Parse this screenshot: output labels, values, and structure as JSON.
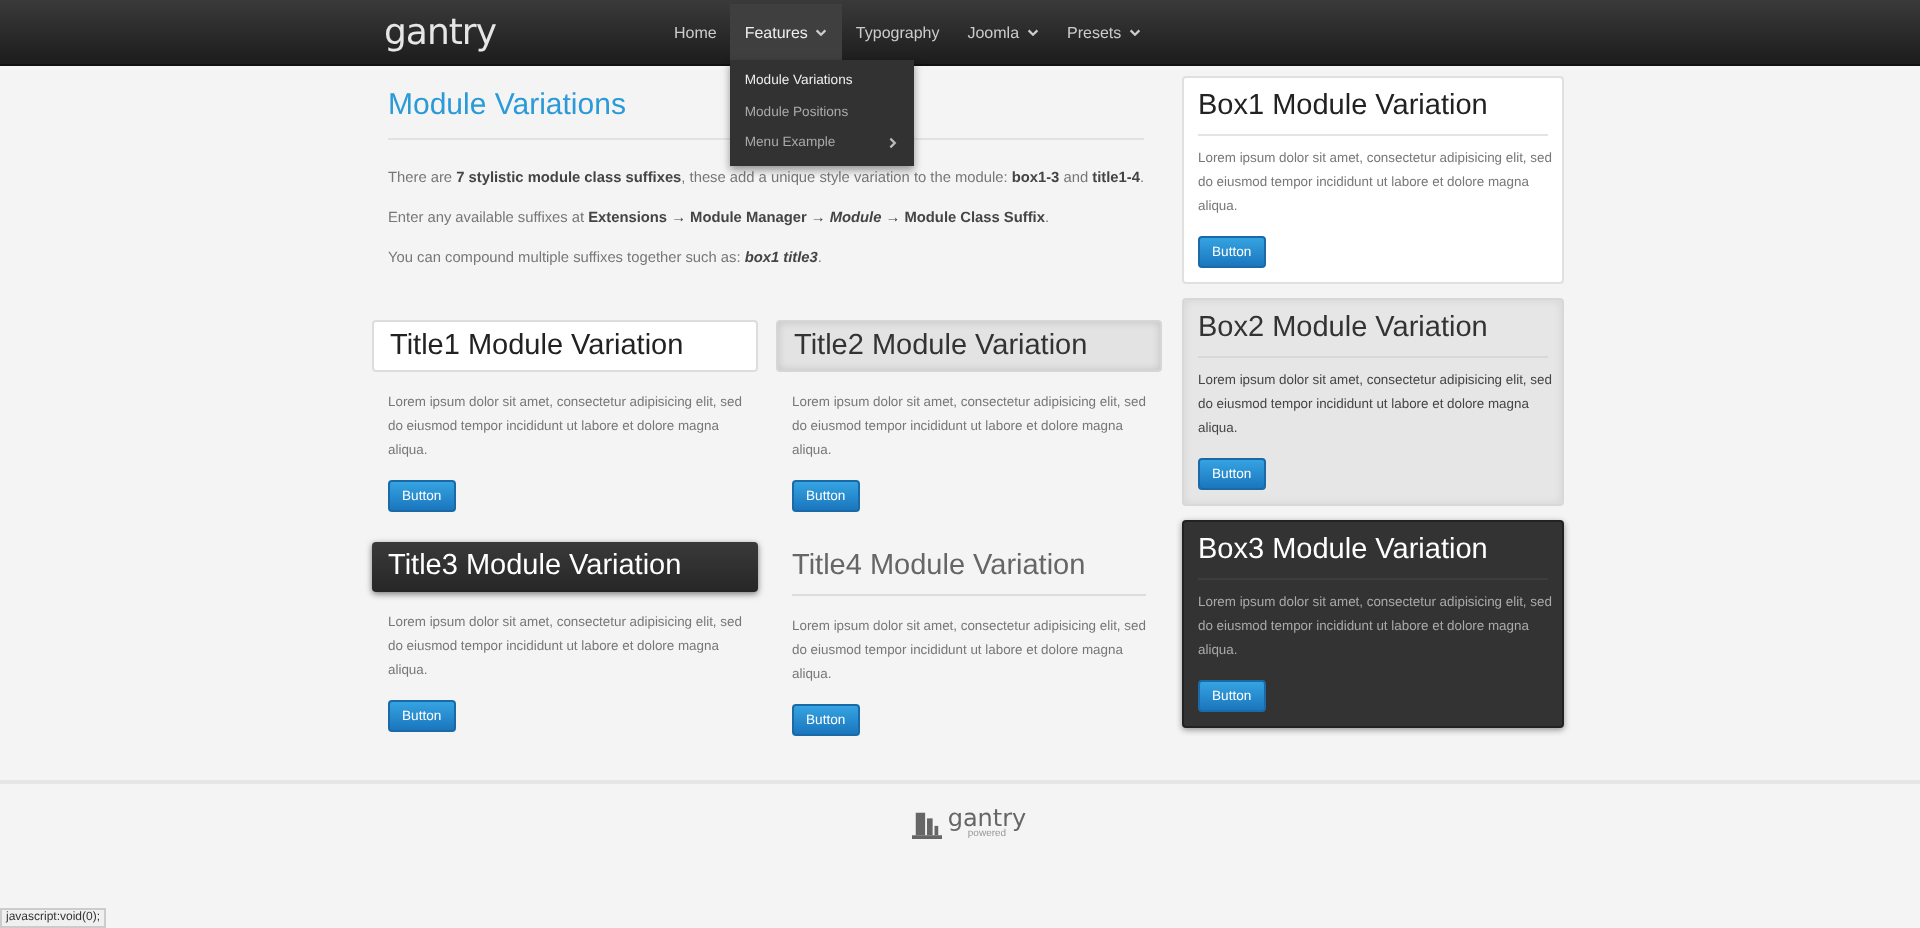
{
  "nav": {
    "logo": "gantry",
    "items": [
      {
        "label": "Home",
        "selected": false,
        "has_menu": false
      },
      {
        "label": "Features",
        "selected": true,
        "has_menu": true
      },
      {
        "label": "Typography",
        "selected": false,
        "has_menu": false
      },
      {
        "label": "Joomla",
        "selected": false,
        "has_menu": true
      },
      {
        "label": "Presets",
        "selected": false,
        "has_menu": true
      }
    ]
  },
  "dropdown": {
    "items": [
      {
        "label": "Module Variations",
        "selected": true,
        "has_submenu": false
      },
      {
        "label": "Module Positions",
        "selected": false,
        "has_submenu": false
      },
      {
        "label": "Menu Example",
        "selected": false,
        "has_submenu": true
      }
    ]
  },
  "intro": {
    "title": "Module Variations",
    "paragraphs": [
      "There are **7 stylistic module class suffixes**, these add a unique style variation to the module: **box1-3** and **title1-4**.",
      "Enter any available suffixes at **Extensions → Module Manager →** *Module* **→ Module Class Suffix**.",
      "You can compound multiple suffixes together such as: *box1 title3*."
    ]
  },
  "modules": [
    {
      "kind": "title1",
      "title": "Title1 Module Variation",
      "text": "Lorem ipsum dolor sit amet, consectetur adipisicing elit, sed do eiusmod tempor incididunt ut labore et dolore magna aliqua.",
      "button": "Button"
    },
    {
      "kind": "title2",
      "title": "Title2 Module Variation",
      "text": "Lorem ipsum dolor sit amet, consectetur adipisicing elit, sed do eiusmod tempor incididunt ut labore et dolore magna aliqua.",
      "button": "Button"
    },
    {
      "kind": "title3",
      "title": "Title3 Module Variation",
      "text": "Lorem ipsum dolor sit amet, consectetur adipisicing elit, sed do eiusmod tempor incididunt ut labore et dolore magna aliqua.",
      "button": "Button"
    },
    {
      "kind": "title4",
      "title": "Title4 Module Variation",
      "text": "Lorem ipsum dolor sit amet, consectetur adipisicing elit, sed do eiusmod tempor incididunt ut labore et dolore magna aliqua.",
      "button": "Button"
    }
  ],
  "boxes": [
    {
      "kind": "box1",
      "title": "Box1 Module Variation",
      "text": "Lorem ipsum dolor sit amet, consectetur adipisicing elit, sed do eiusmod tempor incididunt ut labore et dolore magna aliqua.",
      "button": "Button"
    },
    {
      "kind": "box2",
      "title": "Box2 Module Variation",
      "text": "Lorem ipsum dolor sit amet, consectetur adipisicing elit, sed do eiusmod tempor incididunt ut labore et dolore magna aliqua.",
      "button": "Button"
    },
    {
      "kind": "box3",
      "title": "Box3 Module Variation",
      "text": "Lorem ipsum dolor sit amet, consectetur adipisicing elit, sed do eiusmod tempor incididunt ut labore et dolore magna aliqua.",
      "button": "Button"
    }
  ],
  "footer": {
    "logo": "gantry",
    "tagline": "powered"
  },
  "status_bar": "javascript:void(0);"
}
